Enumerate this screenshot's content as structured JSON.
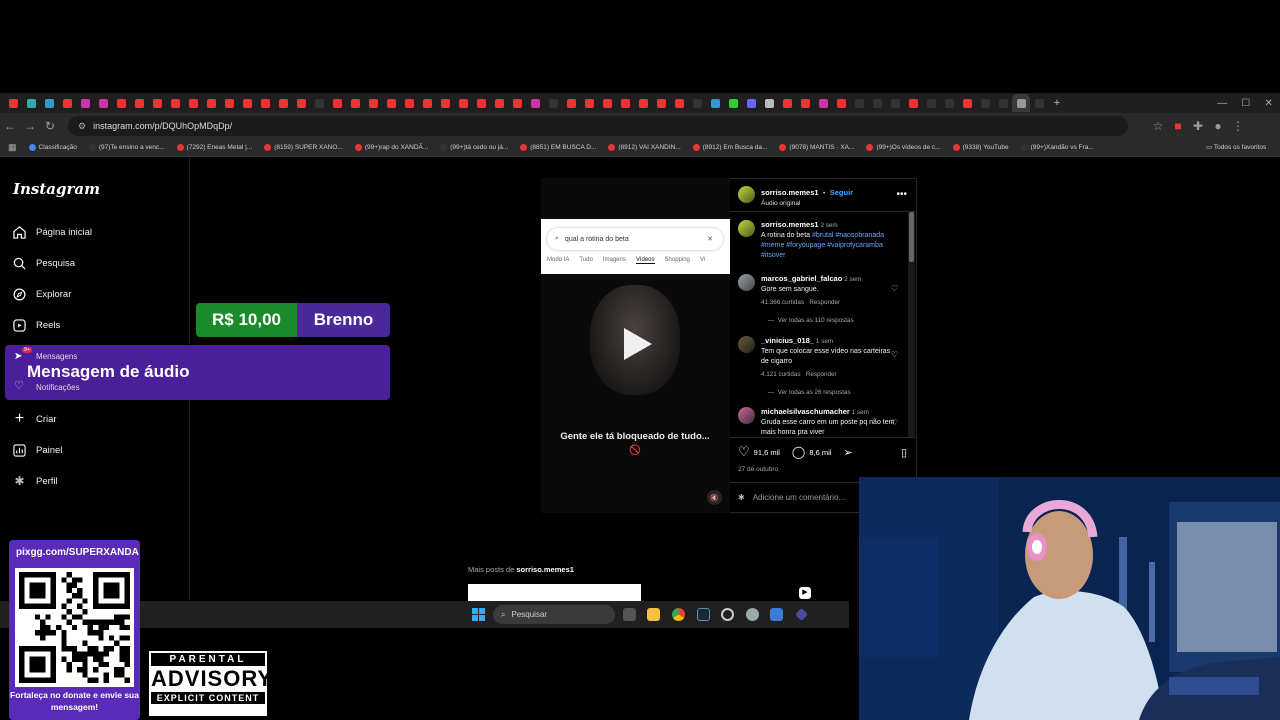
{
  "browser": {
    "url": "instagram.com/p/DQUhOpMDqDp/",
    "bookmarks": [
      "Classificação",
      "(97)Te ensino a venc...",
      "(7292) Eneas Metal |...",
      "(8159) SUPER XANO...",
      "(99+)rap do XANDÃ...",
      "(99+)tá cedo ou já...",
      "(8851) EM BUSCA D...",
      "(8912) VAI XANDIN...",
      "(8912) Em Busca da...",
      "(9078) MANTIS · XA...",
      "(99+)Os vídeos de c...",
      "(9338) YouTube",
      "(99+)Xandão vs Fra..."
    ],
    "all_bookmarks": "Todos os favoritos"
  },
  "instagram": {
    "logo": "Instagram",
    "nav": {
      "home": "Página inicial",
      "search": "Pesquisa",
      "explore": "Explorar",
      "reels": "Reels",
      "messages": "Mensagens",
      "notifications": "Notificações",
      "create": "Criar",
      "dashboard": "Painel",
      "profile": "Perfil",
      "messages_badge": "9+"
    }
  },
  "overlay": {
    "price_amount": "R$ 10,00",
    "price_name": "Brenno",
    "audio_title": "Mensagem de áudio"
  },
  "post": {
    "username": "sorriso.memes1",
    "follow": "Seguir",
    "audio": "Áudio original",
    "search_query": "qual a rotina do beta",
    "search_tabs": [
      "Modo IA",
      "Tudo",
      "Imagens",
      "Vídeos",
      "Shopping",
      "Ví"
    ],
    "video_caption": "Gente ele tá bloqueado de tudo... 🚫",
    "author_comment": {
      "user": "sorriso.memes1",
      "time": "2 sem",
      "text": "A rotina do beta",
      "tags": "#brutal #naosobranada #meme #foryoupage #vaiprofycaramba #itsover"
    },
    "comments": [
      {
        "user": "marcos_gabriel_falcao",
        "time": "2 sem",
        "text": "Gore sem sangue.",
        "likes": "41.366 curtidas",
        "reply": "Responder",
        "view_replies": "Ver todas as 110 respostas"
      },
      {
        "user": "_vinicius_018_",
        "time": "1 sem",
        "text": "Tem que colocar esse vídeo nas carteiras de cigarro",
        "likes": "4.121 curtidas",
        "reply": "Responder",
        "view_replies": "Ver todas as 26 respostas"
      },
      {
        "user": "michaelsilvaschumacher",
        "time": "1 sem",
        "text": "Gruda esse carro em um poste pq não tem mais honra pra viver"
      }
    ],
    "like_count": "91,6 mil",
    "comment_count": "8,6 mil",
    "date": "27 de outubro",
    "add_comment_placeholder": "Adicione um comentário...",
    "more_posts_prefix": "Mais posts de",
    "more_posts_user": "sorriso.memes1"
  },
  "taskbar": {
    "search_placeholder": "Pesquisar"
  },
  "donation": {
    "url": "pixgg.com/SUPERXANDA",
    "text": "Fortaleça no donate e envie sua mensagem!"
  },
  "advisory": {
    "top": "PARENTAL",
    "middle": "ADVISORY",
    "bottom": "EXPLICIT CONTENT"
  },
  "colors": {
    "price_green": "#1a8a2b",
    "banner_purple": "#4c1f9a",
    "donation_purple": "#5a2bb8",
    "link_blue": "#4ea3ff"
  }
}
